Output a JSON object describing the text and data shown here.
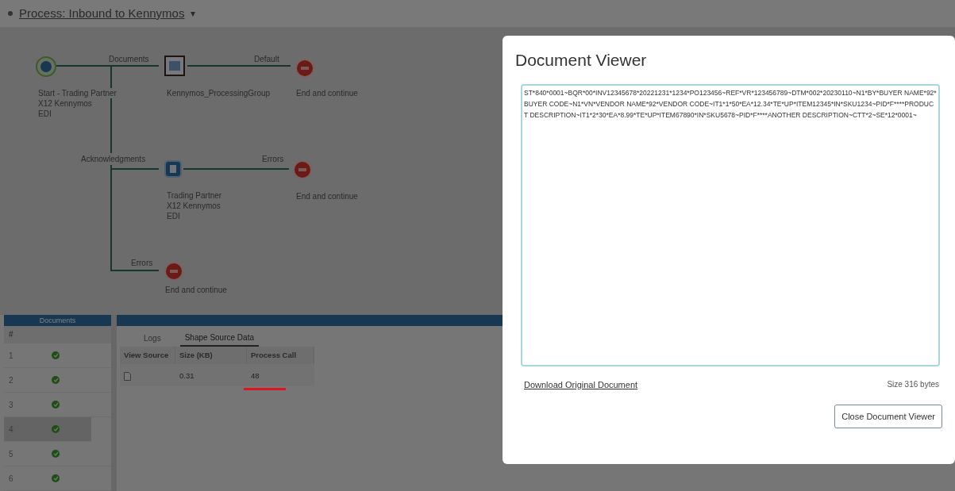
{
  "header": {
    "title": "Process: Inbound to Kennymos",
    "caret": "▾"
  },
  "diagram": {
    "nodes": [
      {
        "kind": "start",
        "lines": [
          "Start - Trading Partner",
          "X12 Kennymos",
          "EDI"
        ]
      },
      {
        "kind": "group",
        "lines": [
          "Kennymos_ProcessingGroup"
        ]
      },
      {
        "kind": "end",
        "lines": [
          "End and continue"
        ]
      },
      {
        "kind": "partner",
        "lines": [
          "Trading Partner",
          "X12 Kennymos",
          "EDI"
        ]
      },
      {
        "kind": "end",
        "lines": [
          "End and continue"
        ]
      },
      {
        "kind": "end",
        "lines": [
          "End and continue"
        ]
      }
    ],
    "edge_labels": [
      "Documents",
      "Default",
      "Acknowledgments",
      "Errors",
      "Errors"
    ]
  },
  "documents_panel": {
    "title": "Documents",
    "column": "#",
    "rows": [
      {
        "number": "1",
        "selected": false
      },
      {
        "number": "2",
        "selected": false
      },
      {
        "number": "3",
        "selected": false
      },
      {
        "number": "4",
        "selected": true
      },
      {
        "number": "5",
        "selected": false
      },
      {
        "number": "6",
        "selected": false
      }
    ]
  },
  "detail_panel": {
    "tabs": [
      {
        "label": "Logs",
        "selected": false
      },
      {
        "label": "Shape Source Data",
        "selected": true
      }
    ],
    "columns": [
      "View Source",
      "Size (KB)",
      "Process Call"
    ],
    "rows": [
      {
        "size": "0.31",
        "process_call": "48"
      }
    ]
  },
  "modal": {
    "title": "Document Viewer",
    "content": "ST*840*0001~BQR*00*INV12345678*20221231*1234*PO123456~REF*VR*123456789~DTM*002*20230110~N1*BY*BUYER NAME*92*BUYER CODE~N1*VN*VENDOR NAME*92*VENDOR CODE~IT1*1*50*EA*12.34*TE*UP*ITEM12345*IN*SKU1234~PID*F****PRODUCT DESCRIPTION~IT1*2*30*EA*8.99*TE*UP*ITEM67890*IN*SKU5678~PID*F****ANOTHER DESCRIPTION~CTT*2~SE*12*0001~",
    "download_link": "Download Original Document",
    "size": "Size 316 bytes",
    "close_button": "Close Document Viewer"
  }
}
